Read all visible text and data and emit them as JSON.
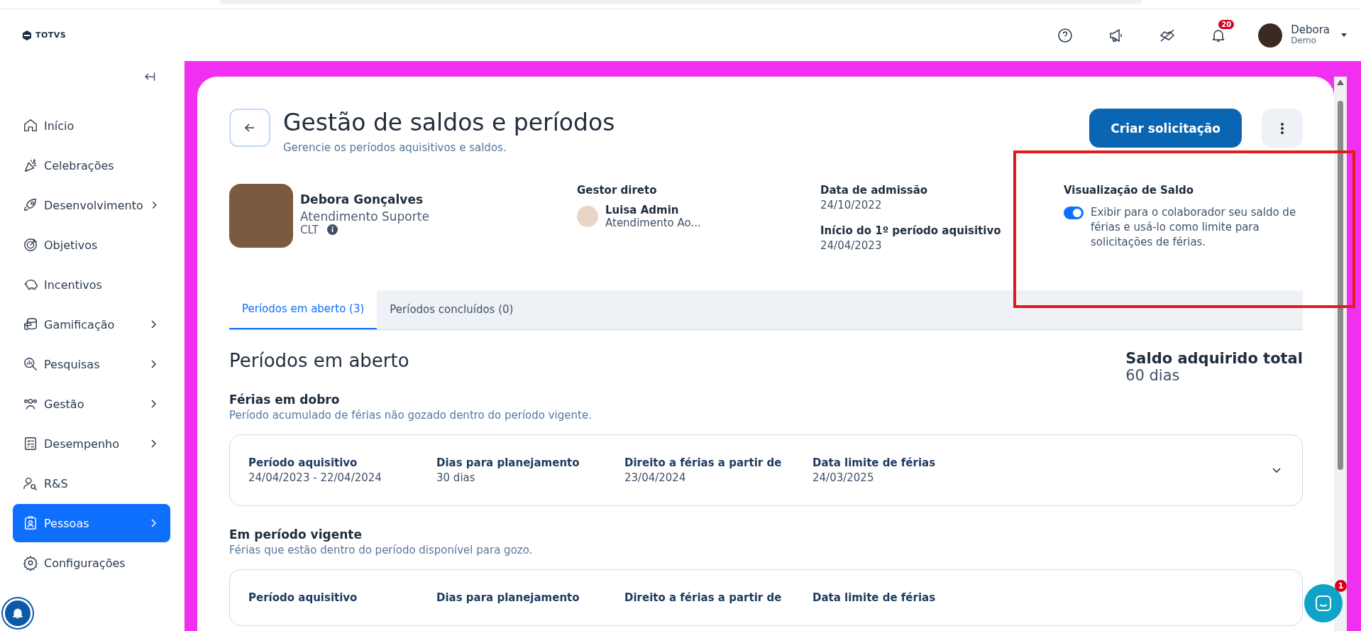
{
  "topbar": {
    "logo": "TOTVS",
    "notifications_badge": "20",
    "user": {
      "name": "Debora",
      "role": "Demo"
    }
  },
  "sidebar": {
    "items": [
      {
        "label": "Início",
        "has_children": false,
        "selected": false
      },
      {
        "label": "Celebrações",
        "has_children": false,
        "selected": false
      },
      {
        "label": "Desenvolvimento",
        "has_children": true,
        "selected": false
      },
      {
        "label": "Objetivos",
        "has_children": false,
        "selected": false
      },
      {
        "label": "Incentivos",
        "has_children": false,
        "selected": false
      },
      {
        "label": "Gamificação",
        "has_children": true,
        "selected": false
      },
      {
        "label": "Pesquisas",
        "has_children": true,
        "selected": false
      },
      {
        "label": "Gestão",
        "has_children": true,
        "selected": false
      },
      {
        "label": "Desempenho",
        "has_children": true,
        "selected": false
      },
      {
        "label": "R&S",
        "has_children": false,
        "selected": false
      },
      {
        "label": "Pessoas",
        "has_children": true,
        "selected": true
      },
      {
        "label": "Configurações",
        "has_children": false,
        "selected": false
      }
    ]
  },
  "page": {
    "title": "Gestão de saldos e períodos",
    "subtitle": "Gerencie os períodos aquisitivos e saldos.",
    "primary_button": "Criar solicitação"
  },
  "employee": {
    "name": "Debora Gonçalves",
    "department": "Atendimento Suporte",
    "contract": "CLT"
  },
  "manager": {
    "label": "Gestor direto",
    "name": "Luisa Admin",
    "department": "Atendimento Ao..."
  },
  "dates": [
    {
      "label": "Data de admissão",
      "value": "24/10/2022"
    },
    {
      "label": "Início do 1º período aquisitivo",
      "value": "24/04/2023"
    }
  ],
  "balance_view": {
    "title": "Visualização de Saldo",
    "on": true,
    "description": "Exibir para o colaborador seu saldo de férias e usá-lo como limite para solicitações de férias."
  },
  "tabs": [
    {
      "label": "Períodos em aberto (3)",
      "selected": true
    },
    {
      "label": "Períodos concluídos (0)",
      "selected": false
    }
  ],
  "section": {
    "title": "Períodos em aberto",
    "total_label": "Saldo adquirido total",
    "total_value": "60 dias"
  },
  "groups": [
    {
      "title": "Férias em dobro",
      "description": "Período acumulado de férias não gozado dentro do período vigente.",
      "expanded": false,
      "fields": [
        {
          "label": "Período aquisitivo",
          "value": "24/04/2023 - 22/04/2024"
        },
        {
          "label": "Dias para planejamento",
          "value": "30 dias"
        },
        {
          "label": "Direito a férias a partir de",
          "value": "23/04/2024"
        },
        {
          "label": "Data limite de férias",
          "value": "24/03/2025"
        }
      ]
    },
    {
      "title": "Em período vigente",
      "description": "Férias que estão dentro do período disponível para gozo.",
      "fields": [
        {
          "label": "Período aquisitivo"
        },
        {
          "label": "Dias para planejamento"
        },
        {
          "label": "Direito a férias a partir de"
        },
        {
          "label": "Data limite de férias"
        }
      ]
    }
  ],
  "chat_badge": "1"
}
